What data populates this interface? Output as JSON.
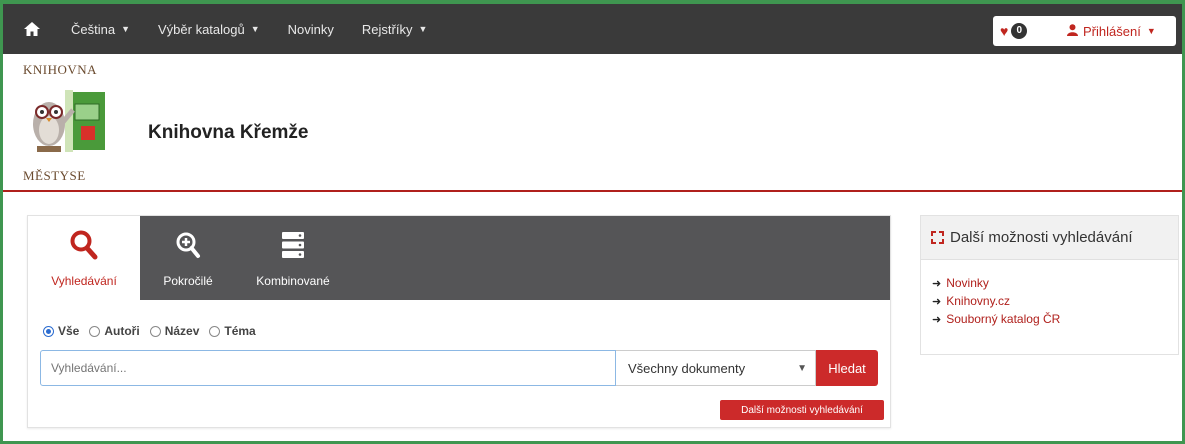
{
  "navbar": {
    "home_icon": "home-icon",
    "items": [
      {
        "label": "Čeština",
        "dropdown": true
      },
      {
        "label": "Výběr katalogů",
        "dropdown": true
      },
      {
        "label": "Novinky",
        "dropdown": false
      },
      {
        "label": "Rejstříky",
        "dropdown": true
      }
    ],
    "favorites_count": "0",
    "login_label": "Přihlášení"
  },
  "header": {
    "logo_top": "KNIHOVNA",
    "logo_bottom": "MĚSTYSE",
    "library_name": "Knihovna Křemže"
  },
  "search": {
    "tabs": [
      {
        "label": "Vyhledávání",
        "icon": "search-icon",
        "active": true
      },
      {
        "label": "Pokročilé",
        "icon": "zoom-in-icon",
        "active": false
      },
      {
        "label": "Kombinované",
        "icon": "server-stack-icon",
        "active": false
      }
    ],
    "radios": [
      {
        "label": "Vše",
        "checked": true
      },
      {
        "label": "Autoři",
        "checked": false
      },
      {
        "label": "Název",
        "checked": false
      },
      {
        "label": "Téma",
        "checked": false
      }
    ],
    "placeholder": "Vyhledávání...",
    "doc_type": "Všechny dokumenty",
    "submit_label": "Hledat",
    "more_label": "Další možnosti vyhledávání"
  },
  "sidebar": {
    "title": "Další možnosti vyhledávání",
    "links": [
      "Novinky",
      "Knihovny.cz",
      "Souborný katalog ČR"
    ]
  },
  "colors": {
    "accent": "#cc2a2a",
    "navbar": "#3a3a3a",
    "tabbar": "#555557",
    "frame": "#3f9650"
  }
}
